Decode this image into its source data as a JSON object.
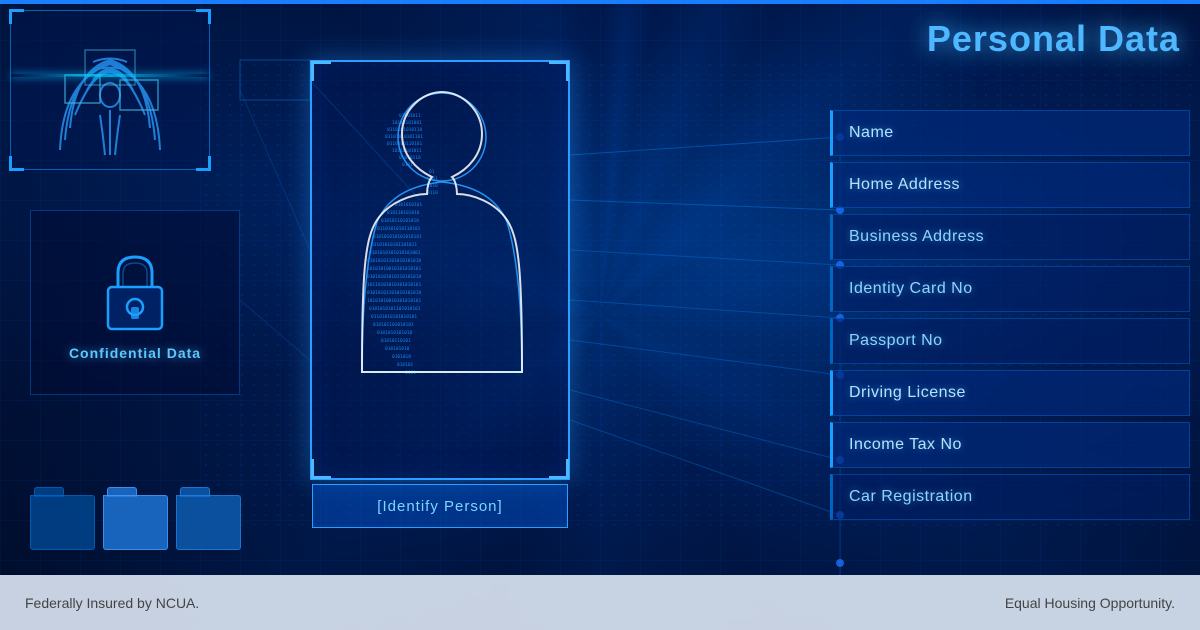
{
  "title": "Personal Data",
  "header": {
    "bar_color": "#1a7fff"
  },
  "fingerprint": {
    "label": "Fingerprint"
  },
  "confidential": {
    "label": "Confidential Data"
  },
  "person_card": {
    "identify_label": "[Identify Person]"
  },
  "data_fields": [
    {
      "id": "name",
      "label": "Name",
      "highlighted": true
    },
    {
      "id": "home-address",
      "label": "Home Address",
      "highlighted": true
    },
    {
      "id": "business-address",
      "label": "Business Address",
      "highlighted": false
    },
    {
      "id": "identity-card-no",
      "label": "Identity Card No",
      "highlighted": false
    },
    {
      "id": "passport-no",
      "label": "Passport No",
      "highlighted": false
    },
    {
      "id": "driving-license",
      "label": "Driving License",
      "highlighted": true
    },
    {
      "id": "income-tax-no",
      "label": "Income Tax No",
      "highlighted": true
    },
    {
      "id": "car-registration",
      "label": "Car Registration",
      "highlighted": false
    }
  ],
  "footer": {
    "left_text": "Federally Insured by NCUA.",
    "right_text": "Equal Housing Opportunity."
  }
}
